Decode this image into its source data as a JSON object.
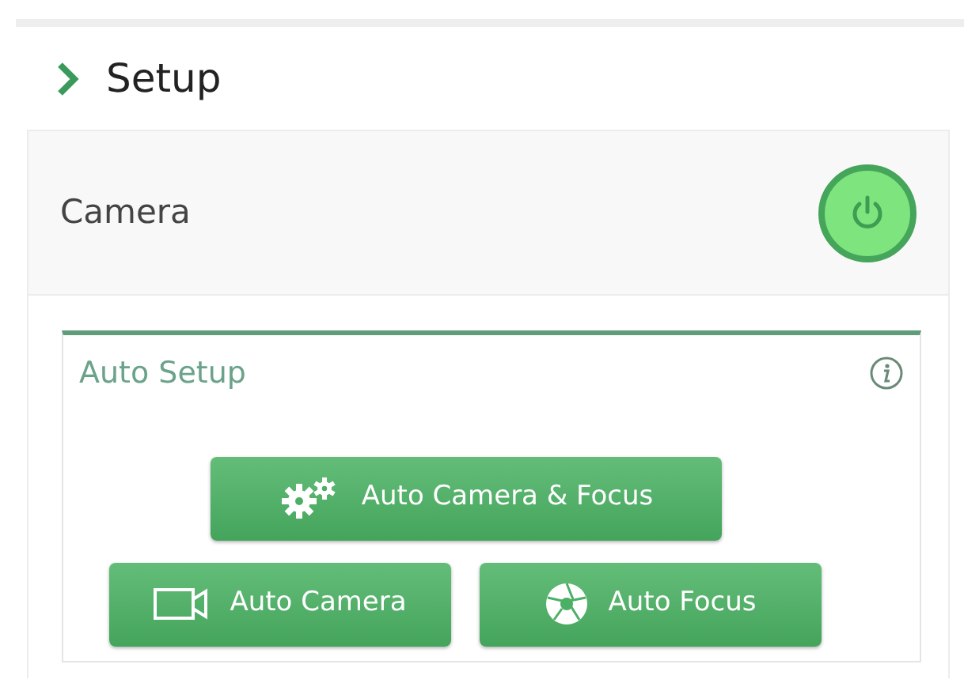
{
  "section": {
    "title": "Setup",
    "expanded": true
  },
  "camera": {
    "label": "Camera",
    "on": true
  },
  "auto_setup": {
    "title": "Auto Setup",
    "buttons": [
      {
        "kind": "gears",
        "label": "Auto Camera & Focus"
      },
      {
        "kind": "camera",
        "label": "Auto Camera"
      },
      {
        "kind": "aperture",
        "label": "Auto Focus"
      }
    ]
  }
}
